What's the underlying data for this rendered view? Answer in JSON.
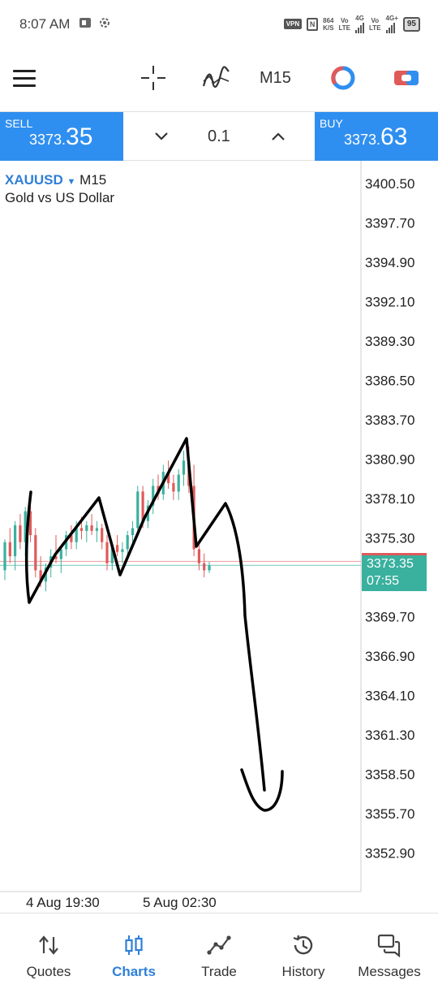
{
  "status_bar": {
    "time": "8:07 AM",
    "vpn": "VPN",
    "nfc": "N",
    "net_speed_value": "864",
    "net_speed_unit": "K/S",
    "volte1_top": "Vo",
    "volte1_bottom": "LTE",
    "net1": "4G",
    "volte2_top": "Vo",
    "volte2_bottom": "LTE",
    "net2": "4G+",
    "battery": "95"
  },
  "toolbar": {
    "timeframe": "M15"
  },
  "trade_panel": {
    "sell_label": "SELL",
    "sell_price_prefix": "3373.",
    "sell_price_big": "35",
    "lot": "0.1",
    "buy_label": "BUY",
    "buy_price_prefix": "3373.",
    "buy_price_big": "63"
  },
  "chart": {
    "symbol": "XAUUSD",
    "timeframe": "M15",
    "description": "Gold vs US Dollar",
    "current_price": "3373.35",
    "countdown": "07:55"
  },
  "chart_data": {
    "type": "candlestick",
    "title": "",
    "y_ticks": [
      "3400.50",
      "3397.70",
      "3394.90",
      "3392.10",
      "3389.30",
      "3386.50",
      "3383.70",
      "3380.90",
      "3378.10",
      "3375.30",
      "3369.70",
      "3366.90",
      "3364.10",
      "3361.30",
      "3358.50",
      "3355.70",
      "3352.90"
    ],
    "x_ticks": [
      "4 Aug 19:30",
      "5 Aug 02:30"
    ],
    "ylim": [
      3352.9,
      3400.5
    ],
    "bid_line": 3373.35,
    "ask_line": 3373.63,
    "colors": {
      "up": "#3ab09e",
      "down": "#e05a5a",
      "drawing": "#000000"
    },
    "candles": [
      [
        3373.0,
        3375.2,
        3372.3,
        3375.0
      ],
      [
        3375.0,
        3376.0,
        3373.5,
        3374.0
      ],
      [
        3374.0,
        3376.5,
        3373.0,
        3376.2
      ],
      [
        3376.2,
        3377.0,
        3374.5,
        3375.0
      ],
      [
        3375.0,
        3377.5,
        3374.0,
        3377.2
      ],
      [
        3377.2,
        3377.8,
        3375.0,
        3375.5
      ],
      [
        3375.5,
        3376.0,
        3372.5,
        3373.0
      ],
      [
        3373.0,
        3374.0,
        3371.8,
        3372.2
      ],
      [
        3372.2,
        3373.5,
        3371.5,
        3373.2
      ],
      [
        3373.2,
        3374.5,
        3372.5,
        3374.0
      ],
      [
        3374.0,
        3375.5,
        3373.5,
        3373.8
      ],
      [
        3373.8,
        3374.8,
        3372.8,
        3374.5
      ],
      [
        3374.5,
        3375.8,
        3374.0,
        3375.5
      ],
      [
        3375.5,
        3376.2,
        3374.5,
        3375.0
      ],
      [
        3375.0,
        3376.5,
        3374.5,
        3376.0
      ],
      [
        3376.0,
        3376.8,
        3375.2,
        3375.8
      ],
      [
        3375.8,
        3376.5,
        3375.0,
        3376.2
      ],
      [
        3376.2,
        3377.0,
        3375.5,
        3375.8
      ],
      [
        3375.8,
        3376.5,
        3375.0,
        3376.0
      ],
      [
        3376.0,
        3376.3,
        3374.5,
        3375.0
      ],
      [
        3375.0,
        3375.5,
        3373.0,
        3373.5
      ],
      [
        3373.5,
        3375.0,
        3373.0,
        3374.8
      ],
      [
        3374.8,
        3375.5,
        3374.0,
        3374.3
      ],
      [
        3374.3,
        3375.0,
        3373.5,
        3374.5
      ],
      [
        3374.5,
        3375.8,
        3374.0,
        3375.5
      ],
      [
        3375.5,
        3376.5,
        3375.0,
        3376.0
      ],
      [
        3376.0,
        3379.0,
        3375.5,
        3378.6
      ],
      [
        3378.6,
        3379.0,
        3376.0,
        3376.5
      ],
      [
        3376.5,
        3378.0,
        3376.0,
        3377.6
      ],
      [
        3377.6,
        3379.5,
        3377.0,
        3379.0
      ],
      [
        3379.0,
        3379.8,
        3378.0,
        3378.4
      ],
      [
        3378.4,
        3380.5,
        3378.0,
        3380.0
      ],
      [
        3380.0,
        3380.8,
        3378.8,
        3379.2
      ],
      [
        3379.2,
        3379.8,
        3378.0,
        3378.6
      ],
      [
        3378.6,
        3380.2,
        3378.0,
        3379.8
      ],
      [
        3379.8,
        3381.5,
        3379.0,
        3380.8
      ],
      [
        3380.8,
        3381.8,
        3378.5,
        3379.0
      ],
      [
        3379.0,
        3380.5,
        3374.0,
        3374.5
      ],
      [
        3374.5,
        3375.0,
        3373.0,
        3373.5
      ],
      [
        3373.5,
        3374.2,
        3372.5,
        3373.0
      ],
      [
        3373.0,
        3373.6,
        3372.8,
        3373.35
      ]
    ]
  },
  "bottom_nav": {
    "items": [
      {
        "label": "Quotes"
      },
      {
        "label": "Charts"
      },
      {
        "label": "Trade"
      },
      {
        "label": "History"
      },
      {
        "label": "Messages"
      }
    ]
  }
}
